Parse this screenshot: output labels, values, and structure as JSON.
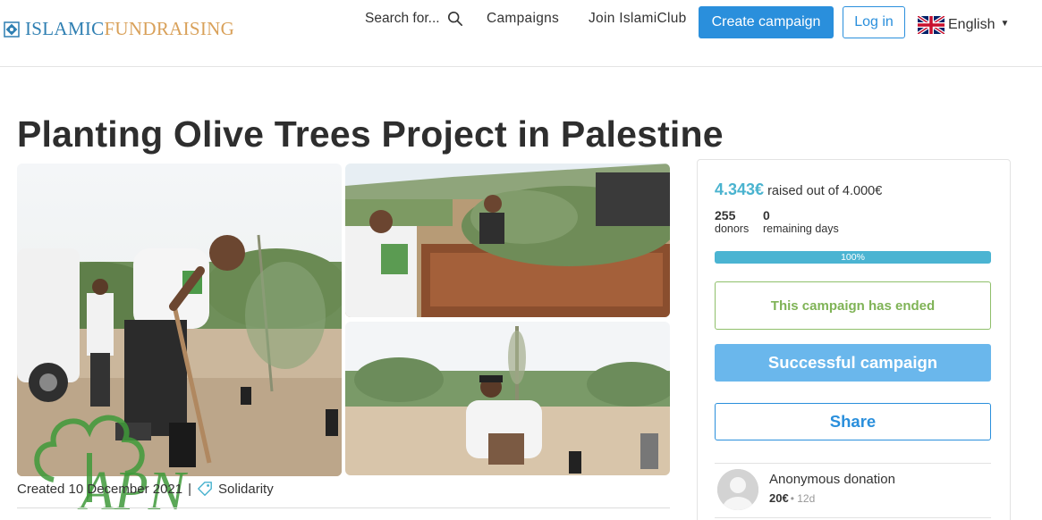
{
  "nav": {
    "logo_part1": "ISLAMIC",
    "logo_part2": "FUNDRAISING",
    "search_label": "Search for...",
    "search_icon": "search-icon",
    "links": [
      "Campaigns",
      "Join IslamiClub"
    ],
    "create_button": "Create campaign",
    "login_button": "Log in",
    "language": "English",
    "language_flag": "uk-flag-icon"
  },
  "campaign": {
    "title": "Planting Olive Trees Project in Palestine",
    "created": "Created 10 December 2021",
    "separator": "|",
    "category": "Solidarity",
    "category_icon": "tag-icon",
    "watermark_text": "APN"
  },
  "funding": {
    "raised_amount": "4.343€",
    "raised_suffix": "raised out of 4.000€",
    "donors_count": "255",
    "donors_label": "donors",
    "days_count": "0",
    "days_label": "remaining days",
    "progress_value": 1.0,
    "progress_label": "100%"
  },
  "actions": {
    "ended_label": "This campaign has ended",
    "success_label": "Successful campaign",
    "share_label": "Share"
  },
  "donation": {
    "name": "Anonymous donation",
    "amount": "20€",
    "time": "• 12d"
  },
  "colors": {
    "primary": "#2a8fdc",
    "raised": "#4ab3cf",
    "ended_green": "#7fb356",
    "success_bg": "#6ab7ec",
    "watermark_green": "#3f9a3a"
  }
}
